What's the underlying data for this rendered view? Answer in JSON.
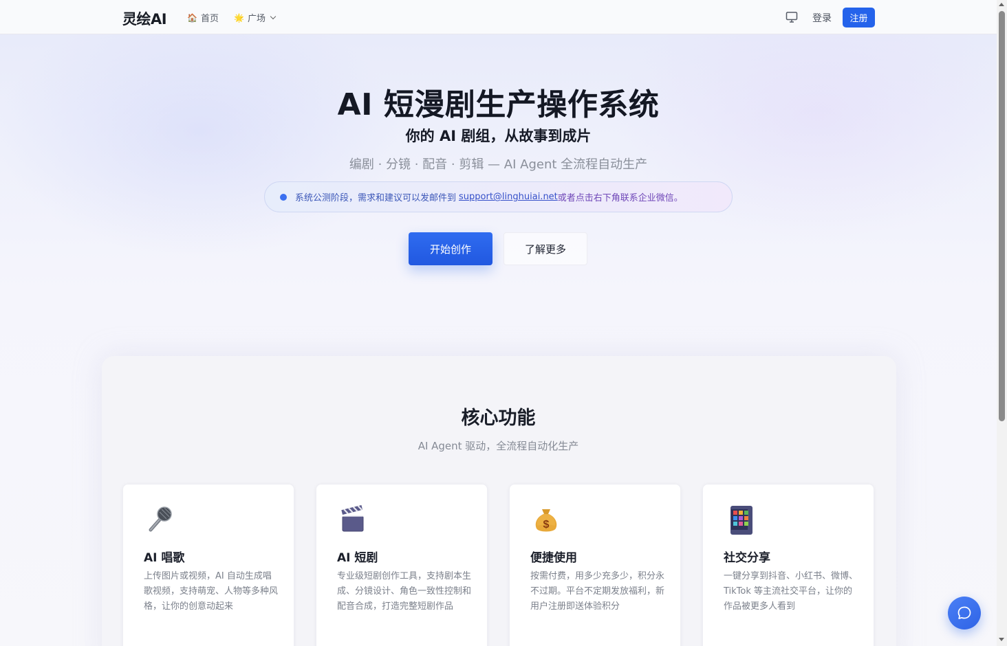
{
  "header": {
    "logo": "灵绘AI",
    "nav": [
      {
        "icon": "house-icon",
        "glyph": "🏠",
        "label": "首页"
      },
      {
        "icon": "sun-icon",
        "glyph": "🌟",
        "label": "广场"
      }
    ],
    "login_label": "登录",
    "register_label": "注册"
  },
  "hero": {
    "title": "AI 短漫剧生产操作系统",
    "subtitle": "你的 AI 剧组，从故事到成片",
    "tagline": "编剧 · 分镜 · 配音 · 剪辑 — AI Agent 全流程自动生产",
    "notice": {
      "prefix": "系统公测阶段，需求和建议可以发邮件到",
      "email": "support@linghuiai.net",
      "suffix": "或者点击右下角联系企业微信。"
    },
    "primary_cta": "开始创作",
    "secondary_cta": "了解更多"
  },
  "features": {
    "title": "核心功能",
    "subtitle": "AI Agent 驱动，全流程自动化生产",
    "cards": [
      {
        "icon": "microphone-icon",
        "title": "AI 唱歌",
        "description": "上传图片或视频，AI 自动生成唱歌视频，支持萌宠、人物等多种风格，让你的创意动起来"
      },
      {
        "icon": "clapperboard-icon",
        "title": "AI 短剧",
        "description": "专业级短剧创作工具，支持剧本生成、分镜设计、角色一致性控制和配音合成，打造完整短剧作品"
      },
      {
        "icon": "money-bag-icon",
        "title": "便捷使用",
        "description": "按需付费，用多少充多少，积分永不过期。平台不定期发放福利，新用户注册即送体验积分"
      },
      {
        "icon": "mobile-apps-icon",
        "title": "社交分享",
        "description": "一键分享到抖音、小红书、微博、TikTok 等主流社交平台，让你的作品被更多人看到"
      }
    ]
  },
  "colors": {
    "accent": "#2563eb",
    "notice_text": "#3c57b8"
  }
}
